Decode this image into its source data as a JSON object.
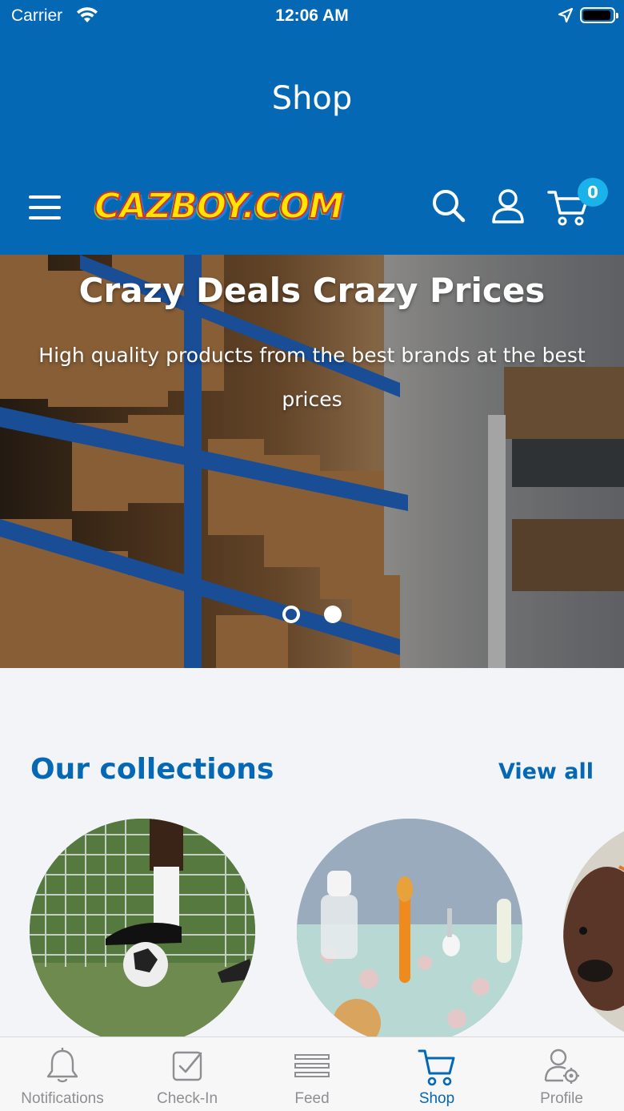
{
  "status_bar": {
    "carrier": "Carrier",
    "time": "12:06 AM"
  },
  "nav": {
    "title": "Shop"
  },
  "store_header": {
    "logo_text": "CAZBOY.COM",
    "cart_count": "0",
    "icons": [
      "menu-icon",
      "search-icon",
      "account-icon",
      "cart-icon"
    ]
  },
  "hero": {
    "title": "Crazy Deals Crazy Prices",
    "subtitle": "High quality products from the best brands at the best prices",
    "slides_count": 2,
    "active_slide": 2
  },
  "collections": {
    "heading": "Our collections",
    "view_all_label": "View all"
  },
  "tab_bar": {
    "items": [
      {
        "label": "Notifications",
        "icon": "bell-icon"
      },
      {
        "label": "Check-In",
        "icon": "checkbox-icon"
      },
      {
        "label": "Feed",
        "icon": "feed-icon"
      },
      {
        "label": "Shop",
        "icon": "cart-icon"
      },
      {
        "label": "Profile",
        "icon": "profile-settings-icon"
      }
    ],
    "active_index": 3
  },
  "colors": {
    "brand_blue": "#0468b5",
    "badge_cyan": "#1ab2e8",
    "inactive_tab": "#8e8e93",
    "background": "#f2f4f7"
  }
}
